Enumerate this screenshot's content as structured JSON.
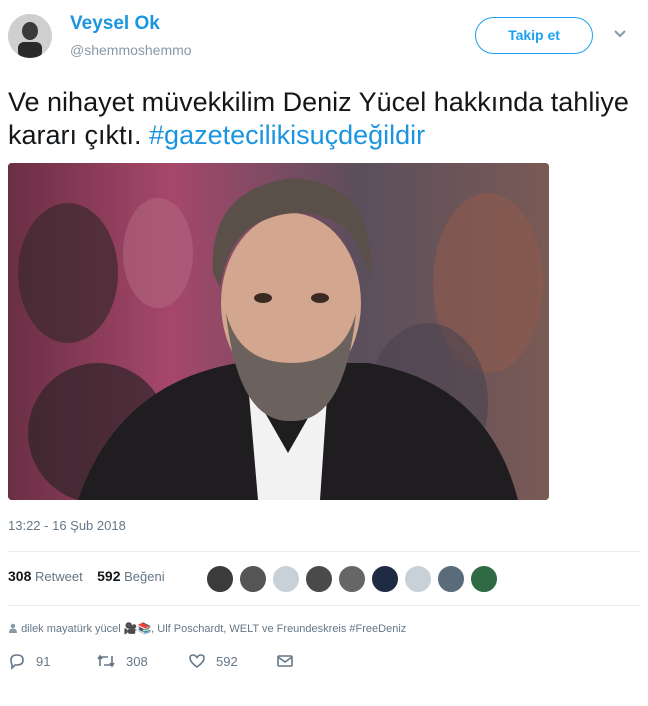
{
  "user": {
    "display_name": "Veysel Ok",
    "handle": "@shemmoshemmo",
    "follow_label": "Takip et"
  },
  "tweet": {
    "text": "Ve nihayet müvekkilim Deniz Yücel hakkında tahliye kararı çıktı. ",
    "hashtag": "#gazetecilikisuçdeğildir",
    "timestamp": "13:22 - 16 Şub 2018"
  },
  "stats": {
    "retweets": "308",
    "retweets_label": "Retweet",
    "likes": "592",
    "likes_label": "Beğeni"
  },
  "context": {
    "text": "dilek mayatürk yücel 🎥📚, Ulf Poschardt, WELT ve Freundeskreis #FreeDeniz"
  },
  "actions": {
    "reply_count": "91",
    "retweet_count": "308",
    "like_count": "592"
  },
  "colors": {
    "link": "#1b95e0",
    "secondary_text": "#657786",
    "accent": "#1da1f2"
  }
}
